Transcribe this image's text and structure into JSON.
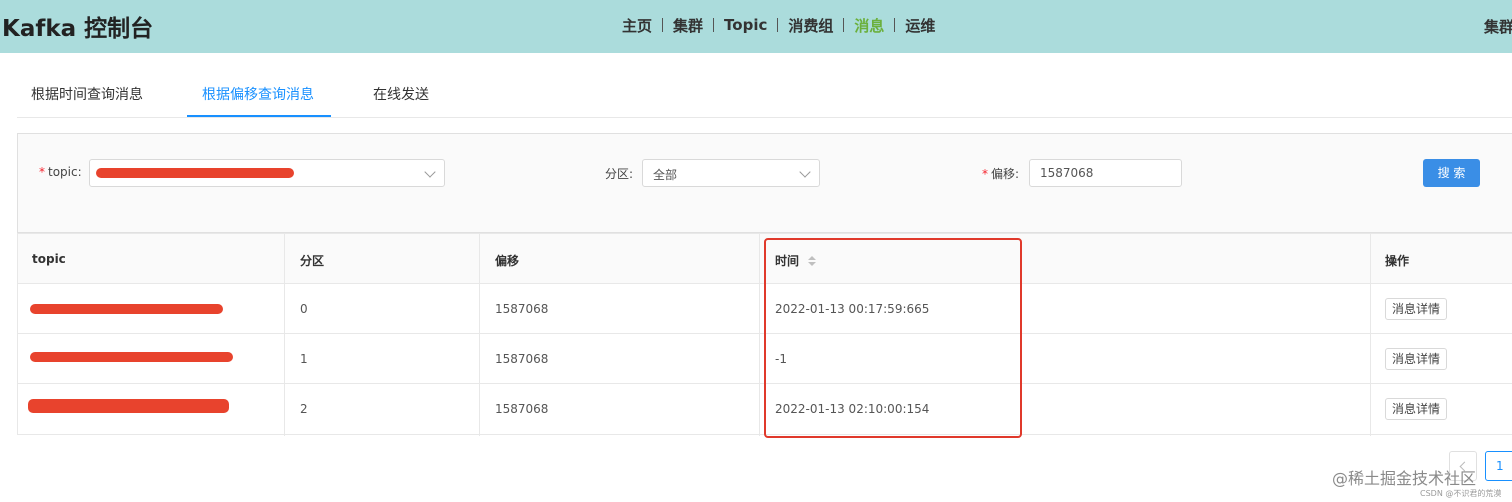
{
  "header": {
    "title": "Kafka 控制台",
    "nav": [
      "主页",
      "集群",
      "Topic",
      "消费组",
      "消息",
      "运维"
    ],
    "nav_active_index": 4,
    "right_text": "集群",
    "colors": {
      "background": "#abdcdc",
      "active": "#6bb03d"
    }
  },
  "tabs": [
    {
      "label": "根据时间查询消息"
    },
    {
      "label": "根据偏移查询消息"
    },
    {
      "label": "在线发送"
    }
  ],
  "active_tab_index": 1,
  "search": {
    "topic_label": "topic",
    "partition_label": "分区",
    "partition_value": "全部",
    "offset_label": "偏移",
    "offset_value": "1587068",
    "search_button": "搜 索"
  },
  "table": {
    "columns": [
      "topic",
      "分区",
      "偏移",
      "时间",
      "操作"
    ],
    "rows": [
      {
        "partition": "0",
        "offset": "1587068",
        "time": "2022-01-13 00:17:59:665",
        "action": "消息详情"
      },
      {
        "partition": "1",
        "offset": "1587068",
        "time": "-1",
        "action": "消息详情"
      },
      {
        "partition": "2",
        "offset": "1587068",
        "time": "2022-01-13 02:10:00:154",
        "action": "消息详情"
      }
    ]
  },
  "pagination": {
    "current_page": "1"
  },
  "watermark": {
    "text": "@稀土掘金技术社区",
    "sub": "CSDN @不识君的荒漠"
  }
}
